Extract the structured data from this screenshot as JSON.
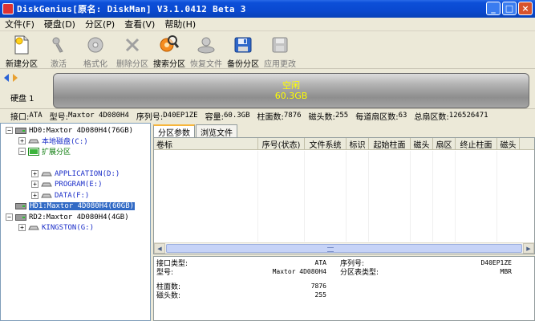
{
  "window": {
    "title": "DiskGenius[原名: DiskMan] V3.1.0412 Beta 3",
    "buttons": [
      "_",
      "□",
      "×"
    ]
  },
  "menu": [
    {
      "label": "文件(F)"
    },
    {
      "label": "硬盘(D)"
    },
    {
      "label": "分区(P)"
    },
    {
      "label": "查看(V)"
    },
    {
      "label": "帮助(H)"
    }
  ],
  "toolbar": [
    {
      "label": "新建分区",
      "icon": "new-partition-icon",
      "enabled": true
    },
    {
      "label": "激活",
      "icon": "activate-icon",
      "enabled": false
    },
    {
      "label": "格式化",
      "icon": "format-icon",
      "enabled": false
    },
    {
      "label": "删除分区",
      "icon": "delete-partition-icon",
      "enabled": false
    },
    {
      "label": "搜索分区",
      "icon": "search-partition-icon",
      "enabled": true
    },
    {
      "label": "恢复文件",
      "icon": "recover-files-icon",
      "enabled": false
    },
    {
      "label": "备份分区",
      "icon": "backup-partition-icon",
      "enabled": true
    },
    {
      "label": "应用更改",
      "icon": "apply-changes-icon",
      "enabled": false
    }
  ],
  "disk_bar": {
    "disk_label": "硬盘 1",
    "segment_label": "空闲",
    "segment_size": "60.3GB"
  },
  "info": {
    "iface_label": "接口:",
    "iface": "ATA",
    "model_label": "型号:",
    "model": "Maxtor 4D080H4",
    "serial_label": "序列号:",
    "serial": "D40EP1ZE",
    "capacity_label": "容量:",
    "capacity": "60.3GB",
    "cylinders_label": "柱面数:",
    "cylinders": "7876",
    "heads_label": "磁头数:",
    "heads": "255",
    "sectors_per_track_label": "每道扇区数:",
    "sectors_per_track": "63",
    "total_sectors_label": "总扇区数:",
    "total_sectors": "126526471"
  },
  "tree": [
    {
      "label": "HD0:Maxtor 4D080H4(76GB)",
      "style": "normal",
      "selected": false
    },
    {
      "label": "本地磁盘(C:)",
      "style": "blue",
      "selected": false
    },
    {
      "label": "扩展分区",
      "style": "green",
      "selected": false
    },
    {
      "label": "APPLICATION(D:)",
      "style": "blue",
      "selected": false
    },
    {
      "label": "PROGRAM(E:)",
      "style": "blue",
      "selected": false
    },
    {
      "label": "DATA(F:)",
      "style": "blue",
      "selected": false
    },
    {
      "label": "HD1:Maxtor 4D080H4(60GB)",
      "style": "normal",
      "selected": true
    },
    {
      "label": "RD2:Maxtor 4D080H4(4GB)",
      "style": "normal",
      "selected": false
    },
    {
      "label": "KINGSTON(G:)",
      "style": "blue",
      "selected": false
    }
  ],
  "tabs": [
    {
      "label": "分区参数",
      "active": true
    },
    {
      "label": "浏览文件",
      "active": false
    }
  ],
  "columns": [
    "卷标",
    "序号(状态)",
    "文件系统",
    "标识",
    "起始柱面",
    "磁头",
    "扇区",
    "终止柱面",
    "磁头"
  ],
  "details": {
    "iface_label": "接口类型:",
    "iface": "ATA",
    "serial_label": "序列号:",
    "serial": "D40EP1ZE",
    "model_label": "型号:",
    "model": "Maxtor 4D080H4",
    "ptable_label": "分区表类型:",
    "ptable": "MBR",
    "cylinders_label": "柱面数:",
    "cylinders": "7876",
    "heads_label": "磁头数:",
    "heads": "255"
  },
  "colors": {
    "titlebar": "#0a49d0",
    "selection": "#316ac5",
    "free_space_text": "#ffff00"
  }
}
